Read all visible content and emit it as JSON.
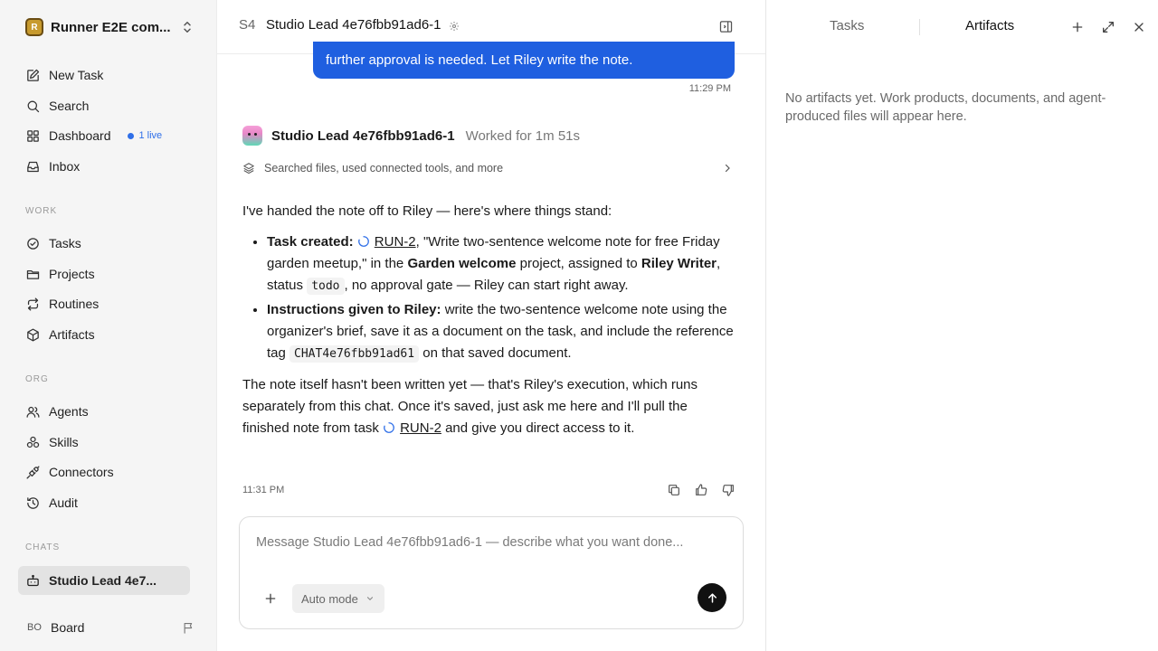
{
  "workspace": {
    "logo_text": "R",
    "name": "Runner E2E com..."
  },
  "sidebar": {
    "primary": [
      {
        "label": "New Task",
        "icon": "edit-icon"
      },
      {
        "label": "Search",
        "icon": "search-icon"
      },
      {
        "label": "Dashboard",
        "icon": "dashboard-icon",
        "badge": "1 live"
      },
      {
        "label": "Inbox",
        "icon": "inbox-icon"
      }
    ],
    "work_heading": "WORK",
    "work": [
      {
        "label": "Tasks",
        "icon": "check-circle-icon"
      },
      {
        "label": "Projects",
        "icon": "folder-icon"
      },
      {
        "label": "Routines",
        "icon": "repeat-icon"
      },
      {
        "label": "Artifacts",
        "icon": "cube-icon"
      }
    ],
    "org_heading": "ORG",
    "org": [
      {
        "label": "Agents",
        "icon": "users-icon"
      },
      {
        "label": "Skills",
        "icon": "skills-icon"
      },
      {
        "label": "Connectors",
        "icon": "plug-icon"
      },
      {
        "label": "Audit",
        "icon": "history-icon"
      }
    ],
    "chats_heading": "CHATS",
    "chats": [
      {
        "label": "Studio Lead 4e7...",
        "icon": "bot-icon"
      }
    ],
    "board": {
      "initials": "BO",
      "label": "Board"
    }
  },
  "chat": {
    "badge": "S4",
    "title": "Studio Lead 4e76fbb91ad6-1",
    "user_message_tail": "further approval is needed. Let Riley write the note.",
    "user_time": "11:29 PM",
    "agent_name": "Studio Lead 4e76fbb91ad6-1",
    "worked": "Worked for 1m 51s",
    "tools_summary": "Searched files, used connected tools, and more",
    "intro": "I've handed the note off to Riley — here's where things stand:",
    "b1_label": "Task created:",
    "b1_run": "RUN-2",
    "b1_a": ", \"Write two-sentence welcome note for free Friday garden meetup,\" in the ",
    "b1_project": "Garden welcome",
    "b1_b": " project, assigned to ",
    "b1_assignee": "Riley Writer",
    "b1_c": ", status ",
    "b1_status": "todo",
    "b1_d": ", no approval gate — Riley can start right away.",
    "b2_label": "Instructions given to Riley:",
    "b2_a": " write the two-sentence welcome note using the organizer's brief, save it as a document on the task, and include the reference tag ",
    "b2_tag": "CHAT4e76fbb91ad61",
    "b2_b": " on that saved document.",
    "p2_a": "The note itself hasn't been written yet — that's Riley's execution, which runs separately from this chat. Once it's saved, just ask me here and I'll pull the finished note from task ",
    "p2_run": "RUN-2",
    "p2_b": " and give you direct access to it.",
    "agent_time": "11:31 PM",
    "composer_placeholder": "Message Studio Lead 4e76fbb91ad6-1 — describe what you want done...",
    "mode_label": "Auto mode"
  },
  "right": {
    "tab_tasks": "Tasks",
    "tab_artifacts": "Artifacts",
    "empty_text": "No artifacts yet. Work products, documents, and agent-produced files will appear here."
  },
  "colors": {
    "accent": "#1f5fe0",
    "live": "#2f6fe8",
    "sidebar_bg": "#f5f5f5"
  }
}
